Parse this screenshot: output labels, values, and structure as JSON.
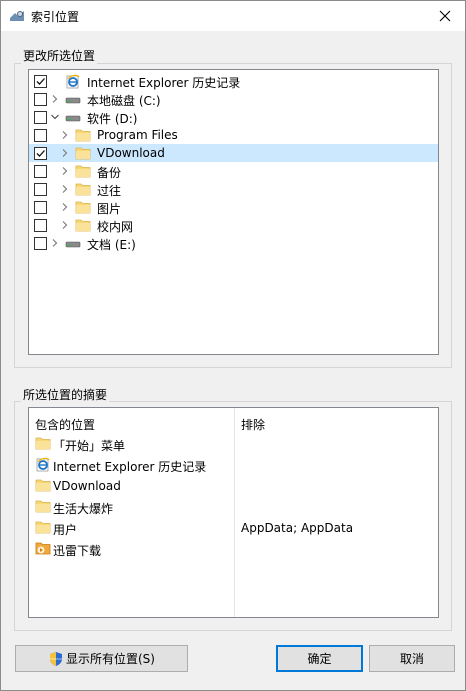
{
  "window": {
    "title": "索引位置"
  },
  "change_group": {
    "label": "更改所选位置",
    "items": [
      {
        "label": "Internet Explorer 历史记录",
        "checked": true,
        "has_chevron": false,
        "expanded": false,
        "icon": "ie-icon"
      },
      {
        "label": "本地磁盘 (C:)",
        "checked": false,
        "has_chevron": true,
        "expanded": false,
        "icon": "drive-icon"
      },
      {
        "label": "软件 (D:)",
        "checked": false,
        "has_chevron": true,
        "expanded": true,
        "icon": "drive-icon"
      },
      {
        "label": "Program Files",
        "checked": false,
        "has_chevron": true,
        "expanded": false,
        "icon": "folder-icon"
      },
      {
        "label": "VDownload",
        "checked": true,
        "has_chevron": true,
        "expanded": false,
        "icon": "folder-icon",
        "selected": true
      },
      {
        "label": "备份",
        "checked": false,
        "has_chevron": true,
        "expanded": false,
        "icon": "folder-icon"
      },
      {
        "label": "过往",
        "checked": false,
        "has_chevron": true,
        "expanded": false,
        "icon": "folder-icon"
      },
      {
        "label": "图片",
        "checked": false,
        "has_chevron": true,
        "expanded": false,
        "icon": "folder-icon"
      },
      {
        "label": "校内网",
        "checked": false,
        "has_chevron": true,
        "expanded": false,
        "icon": "folder-icon"
      },
      {
        "label": "文档 (E:)",
        "checked": false,
        "has_chevron": true,
        "expanded": false,
        "icon": "drive-icon"
      }
    ]
  },
  "summary_group": {
    "label": "所选位置的摘要",
    "included_header": "包含的位置",
    "excluded_header": "排除",
    "included": [
      {
        "label": "「开始」菜单",
        "icon": "folder-icon"
      },
      {
        "label": "Internet Explorer 历史记录",
        "icon": "ie-icon"
      },
      {
        "label": "VDownload",
        "icon": "folder-icon"
      },
      {
        "label": "生活大爆炸",
        "icon": "folder-icon"
      },
      {
        "label": "用户",
        "icon": "folder-icon",
        "excluded": "AppData; AppData"
      },
      {
        "label": "迅雷下载",
        "icon": "thunder-folder-icon"
      }
    ]
  },
  "buttons": {
    "show_all": "显示所有位置(S)",
    "ok": "确定",
    "cancel": "取消"
  },
  "colors": {
    "selection": "#cce8ff",
    "folder": "#f8d775",
    "accent": "#0078d7"
  }
}
